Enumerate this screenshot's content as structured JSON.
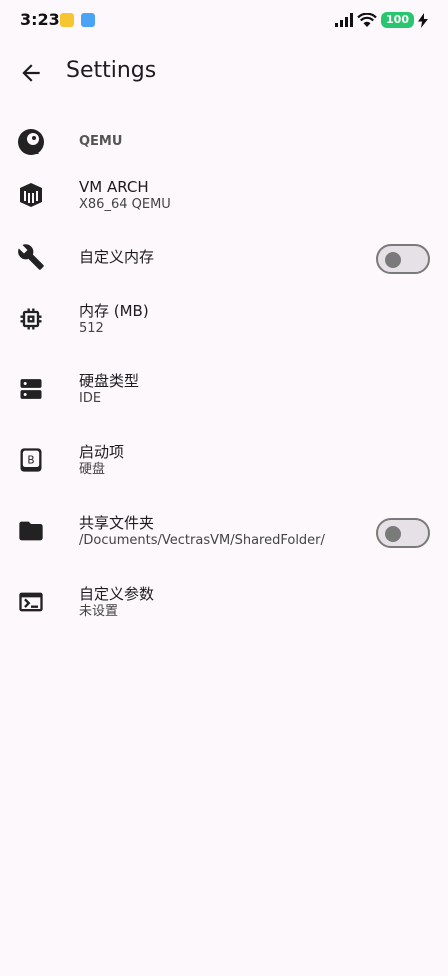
{
  "status_bar": {
    "time": "3:23",
    "battery": "100"
  },
  "app_bar": {
    "title": "Settings"
  },
  "settings": [
    {
      "title": "QEMU",
      "subtitle": "",
      "icon": "qemu-logo-icon",
      "has_switch": false
    },
    {
      "title": "VM ARCH",
      "subtitle": "X86_64 QEMU",
      "icon": "chip-box-icon",
      "has_switch": false
    },
    {
      "title": "自定义内存",
      "subtitle": "",
      "icon": "wrench-icon",
      "has_switch": true,
      "switch_on": false
    },
    {
      "title": "内存 (MB)",
      "subtitle": "512",
      "icon": "memory-chip-icon",
      "has_switch": false
    },
    {
      "title": "硬盘类型",
      "subtitle": "IDE",
      "icon": "storage-icon",
      "has_switch": false
    },
    {
      "title": "启动项",
      "subtitle": "硬盘",
      "icon": "boot-icon",
      "has_switch": false
    },
    {
      "title": "共享文件夹",
      "subtitle": "/Documents/VectrasVM/SharedFolder/",
      "icon": "folder-icon",
      "has_switch": true,
      "switch_on": false
    },
    {
      "title": "自定义参数",
      "subtitle": "未设置",
      "icon": "terminal-icon",
      "has_switch": false
    }
  ],
  "colors": {
    "background": "#fdf8fc",
    "battery": "#28c76f",
    "switch_border": "#7a7a7a"
  }
}
